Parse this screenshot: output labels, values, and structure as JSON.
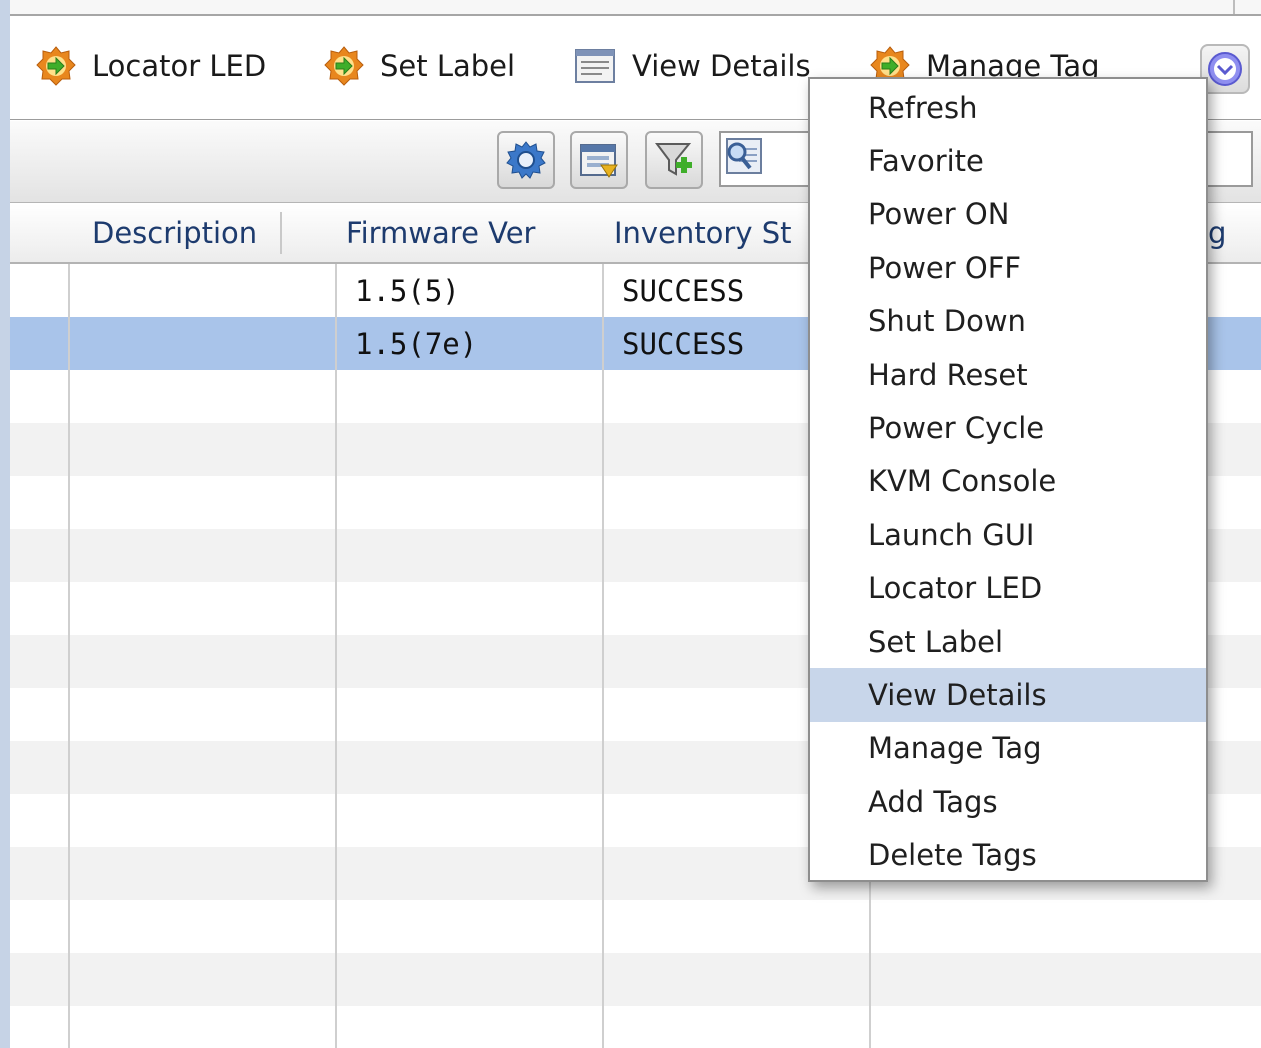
{
  "toolbar": {
    "actions": [
      {
        "label": "Locator LED",
        "icon": "gear-arrow-icon"
      },
      {
        "label": "Set Label",
        "icon": "gear-arrow-icon"
      },
      {
        "label": "View Details",
        "icon": "details-icon"
      },
      {
        "label": "Manage Tag",
        "icon": "gear-arrow-icon"
      }
    ],
    "more_icon": "chevron-down-circle-icon"
  },
  "filter_bar": {
    "buttons": [
      "settings-icon",
      "export-icon",
      "add-filter-icon"
    ],
    "search_icon": "search-icon",
    "search_value": ""
  },
  "table": {
    "columns": [
      "Description",
      "Firmware Ver",
      "Inventory St",
      "g"
    ],
    "rows": [
      {
        "description": "",
        "firmware": "1.5(5)",
        "inventory": "SUCCESS",
        "selected": false
      },
      {
        "description": "",
        "firmware": "1.5(7e)",
        "inventory": "SUCCESS",
        "selected": true
      }
    ]
  },
  "context_menu": {
    "items": [
      "Refresh",
      "Favorite",
      "Power ON",
      "Power OFF",
      "Shut Down",
      "Hard Reset",
      "Power Cycle",
      "KVM Console",
      "Launch GUI",
      "Locator LED",
      "Set Label",
      "View Details",
      "Manage Tag",
      "Add Tags",
      "Delete Tags"
    ],
    "highlighted": "View Details"
  },
  "colors": {
    "selection": "#a9c4ea",
    "menu_highlight": "#c8d6ea",
    "header_text": "#1d3b6e",
    "icon_orange": "#e8871e",
    "icon_green": "#3fae2a"
  }
}
